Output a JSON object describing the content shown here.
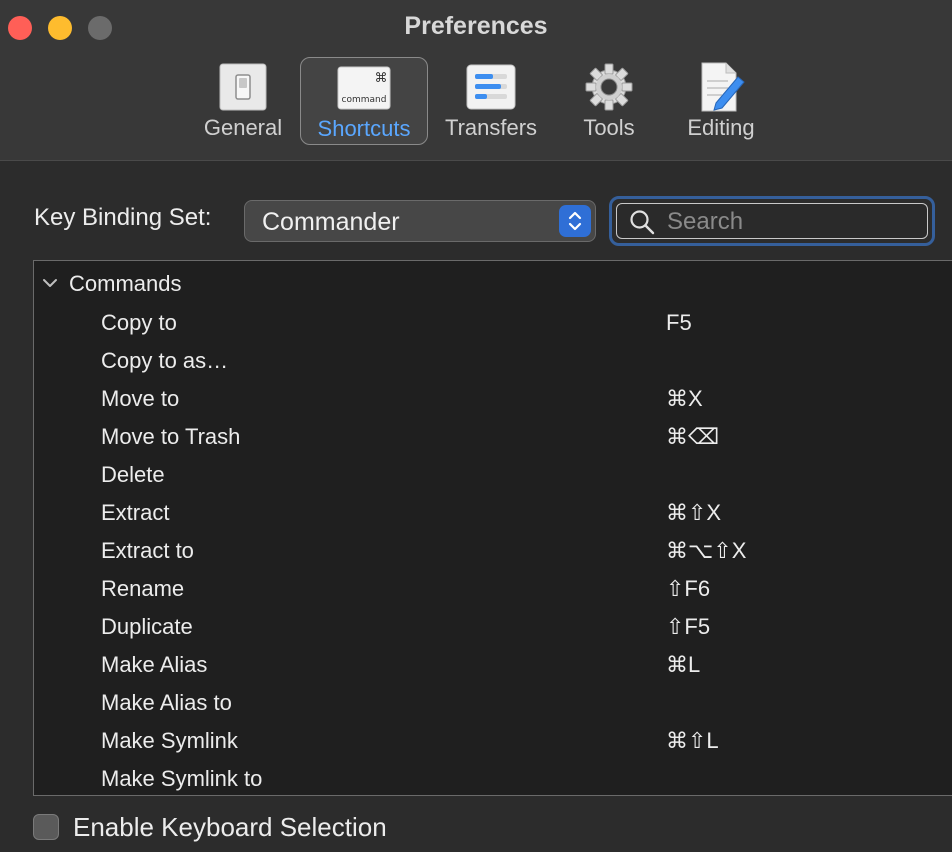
{
  "window": {
    "title": "Preferences"
  },
  "toolbar": {
    "tabs": [
      {
        "label": "General",
        "icon": "toggle-switch-icon"
      },
      {
        "label": "Shortcuts",
        "icon": "command-key-icon",
        "icon_text_top": "⌘",
        "icon_text_bottom": "command",
        "active": true
      },
      {
        "label": "Transfers",
        "icon": "sliders-icon"
      },
      {
        "label": "Tools",
        "icon": "gear-icon"
      },
      {
        "label": "Editing",
        "icon": "document-pencil-icon"
      }
    ]
  },
  "keybinding": {
    "label": "Key Binding Set:",
    "selected": "Commander"
  },
  "search": {
    "placeholder": "Search"
  },
  "list": {
    "group": "Commands",
    "rows": [
      {
        "command": "Copy to",
        "key": "F5"
      },
      {
        "command": "Copy to as…",
        "key": ""
      },
      {
        "command": "Move to",
        "key": "⌘X"
      },
      {
        "command": "Move to Trash",
        "key": "⌘⌫"
      },
      {
        "command": "Delete",
        "key": ""
      },
      {
        "command": "Extract",
        "key": "⌘⇧X"
      },
      {
        "command": "Extract to",
        "key": "⌘⌥⇧X"
      },
      {
        "command": "Rename",
        "key": "⇧F6"
      },
      {
        "command": "Duplicate",
        "key": "⇧F5"
      },
      {
        "command": "Make Alias",
        "key": "⌘L"
      },
      {
        "command": "Make Alias to",
        "key": ""
      },
      {
        "command": "Make Symlink",
        "key": "⌘⇧L"
      },
      {
        "command": "Make Symlink to",
        "key": ""
      }
    ]
  },
  "footer": {
    "checkbox_label": "Enable Keyboard Selection",
    "checked": false
  },
  "colors": {
    "accent": "#2f6fd6",
    "active_tab_label": "#5aa7ff",
    "close": "#ff5f57",
    "minimize": "#febc2e"
  }
}
